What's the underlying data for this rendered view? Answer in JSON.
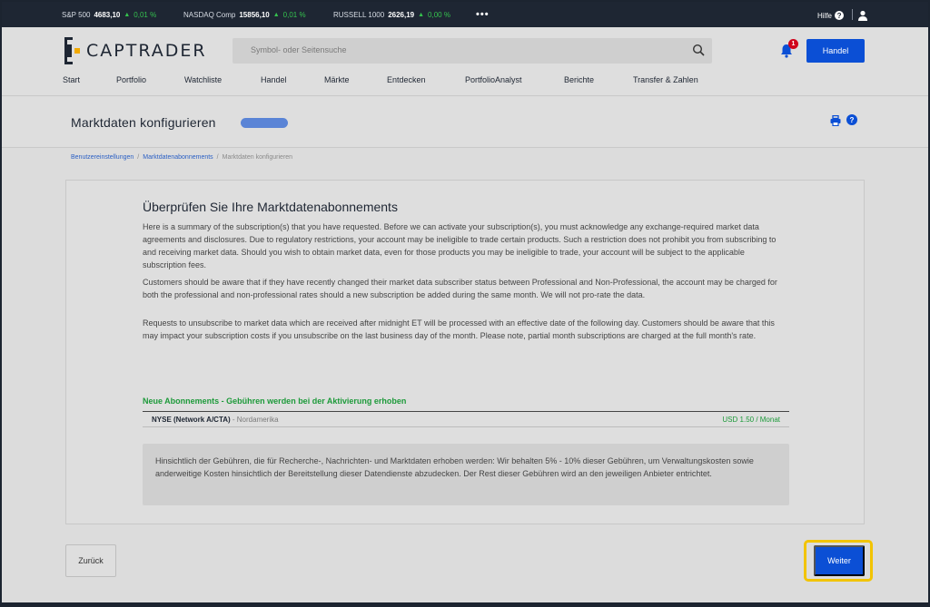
{
  "ticker": {
    "items": [
      {
        "name": "S&P 500",
        "value": "4683,10",
        "change": "0,01 %"
      },
      {
        "name": "NASDAQ Comp",
        "value": "15856,10",
        "change": "0,01 %"
      },
      {
        "name": "RUSSELL 1000",
        "value": "2626,19",
        "change": "0,00 %"
      }
    ],
    "more": "•••",
    "help_label": "Hilfe"
  },
  "header": {
    "logo_text": "CAPTRADER",
    "search_placeholder": "Symbol- oder Seitensuche",
    "notification_count": "1",
    "trade_button": "Handel"
  },
  "nav": [
    "Start",
    "Portfolio",
    "Watchliste",
    "Handel",
    "Märkte",
    "Entdecken",
    "PortfolioAnalyst",
    "Berichte",
    "Transfer & Zahlen"
  ],
  "page": {
    "title": "Marktdaten konfigurieren"
  },
  "breadcrumb": [
    "Benutzereinstellungen",
    "Marktdatenabonnements",
    "Marktdaten konfigurieren"
  ],
  "review": {
    "title": "Überprüfen Sie Ihre Marktdatenabonnements",
    "paragraphs": [
      "Here is a summary of the subscription(s) that you have requested. Before we can activate your subscription(s), you must acknowledge any exchange-required market data agreements and disclosures. Due to regulatory restrictions, your account may be ineligible to trade certain products. Such a restriction does not prohibit you from subscribing to and receiving market data. Should you wish to obtain market data, even for those products you may be ineligible to trade, your account will be subject to the applicable subscription fees.",
      "Customers should be aware that if they have recently changed their market data subscriber status between Professional and Non-Professional, the account may be charged for both the professional and non-professional rates should a new subscription be added during the same month. We will not pro-rate the data.",
      "Requests to unsubscribe to market data which are received after midnight ET will be processed with an effective date of the following day. Customers should be aware that this may impact your subscription costs if you unsubscribe on the last business day of the month. Please note, partial month subscriptions are charged at the full month's rate."
    ],
    "new_subs_heading": "Neue Abonnements - Gebühren werden bei der Aktivierung erhoben",
    "subscription": {
      "name": "NYSE (Network A/CTA)",
      "region": " - Nordamerika",
      "price": "USD 1.50 / Monat"
    },
    "fee_note": "Hinsichtlich der Gebühren, die für Recherche-, Nachrichten- und Marktdaten erhoben werden: Wir behalten 5% - 10% dieser Gebühren, um Verwaltungskosten sowie anderweitige Kosten hinsichtlich der Bereitstellung dieser Datendienste abzudecken. Der Rest dieser Gebühren wird an den jeweiligen Anbieter entrichtet."
  },
  "footer": {
    "back_button": "Zurück",
    "next_button": "Weiter"
  },
  "colors": {
    "brand_blue": "#0b4fd5",
    "positive_green": "#1d9a3a",
    "highlight_yellow": "#f2c400",
    "dark_bar": "#1e2633"
  }
}
